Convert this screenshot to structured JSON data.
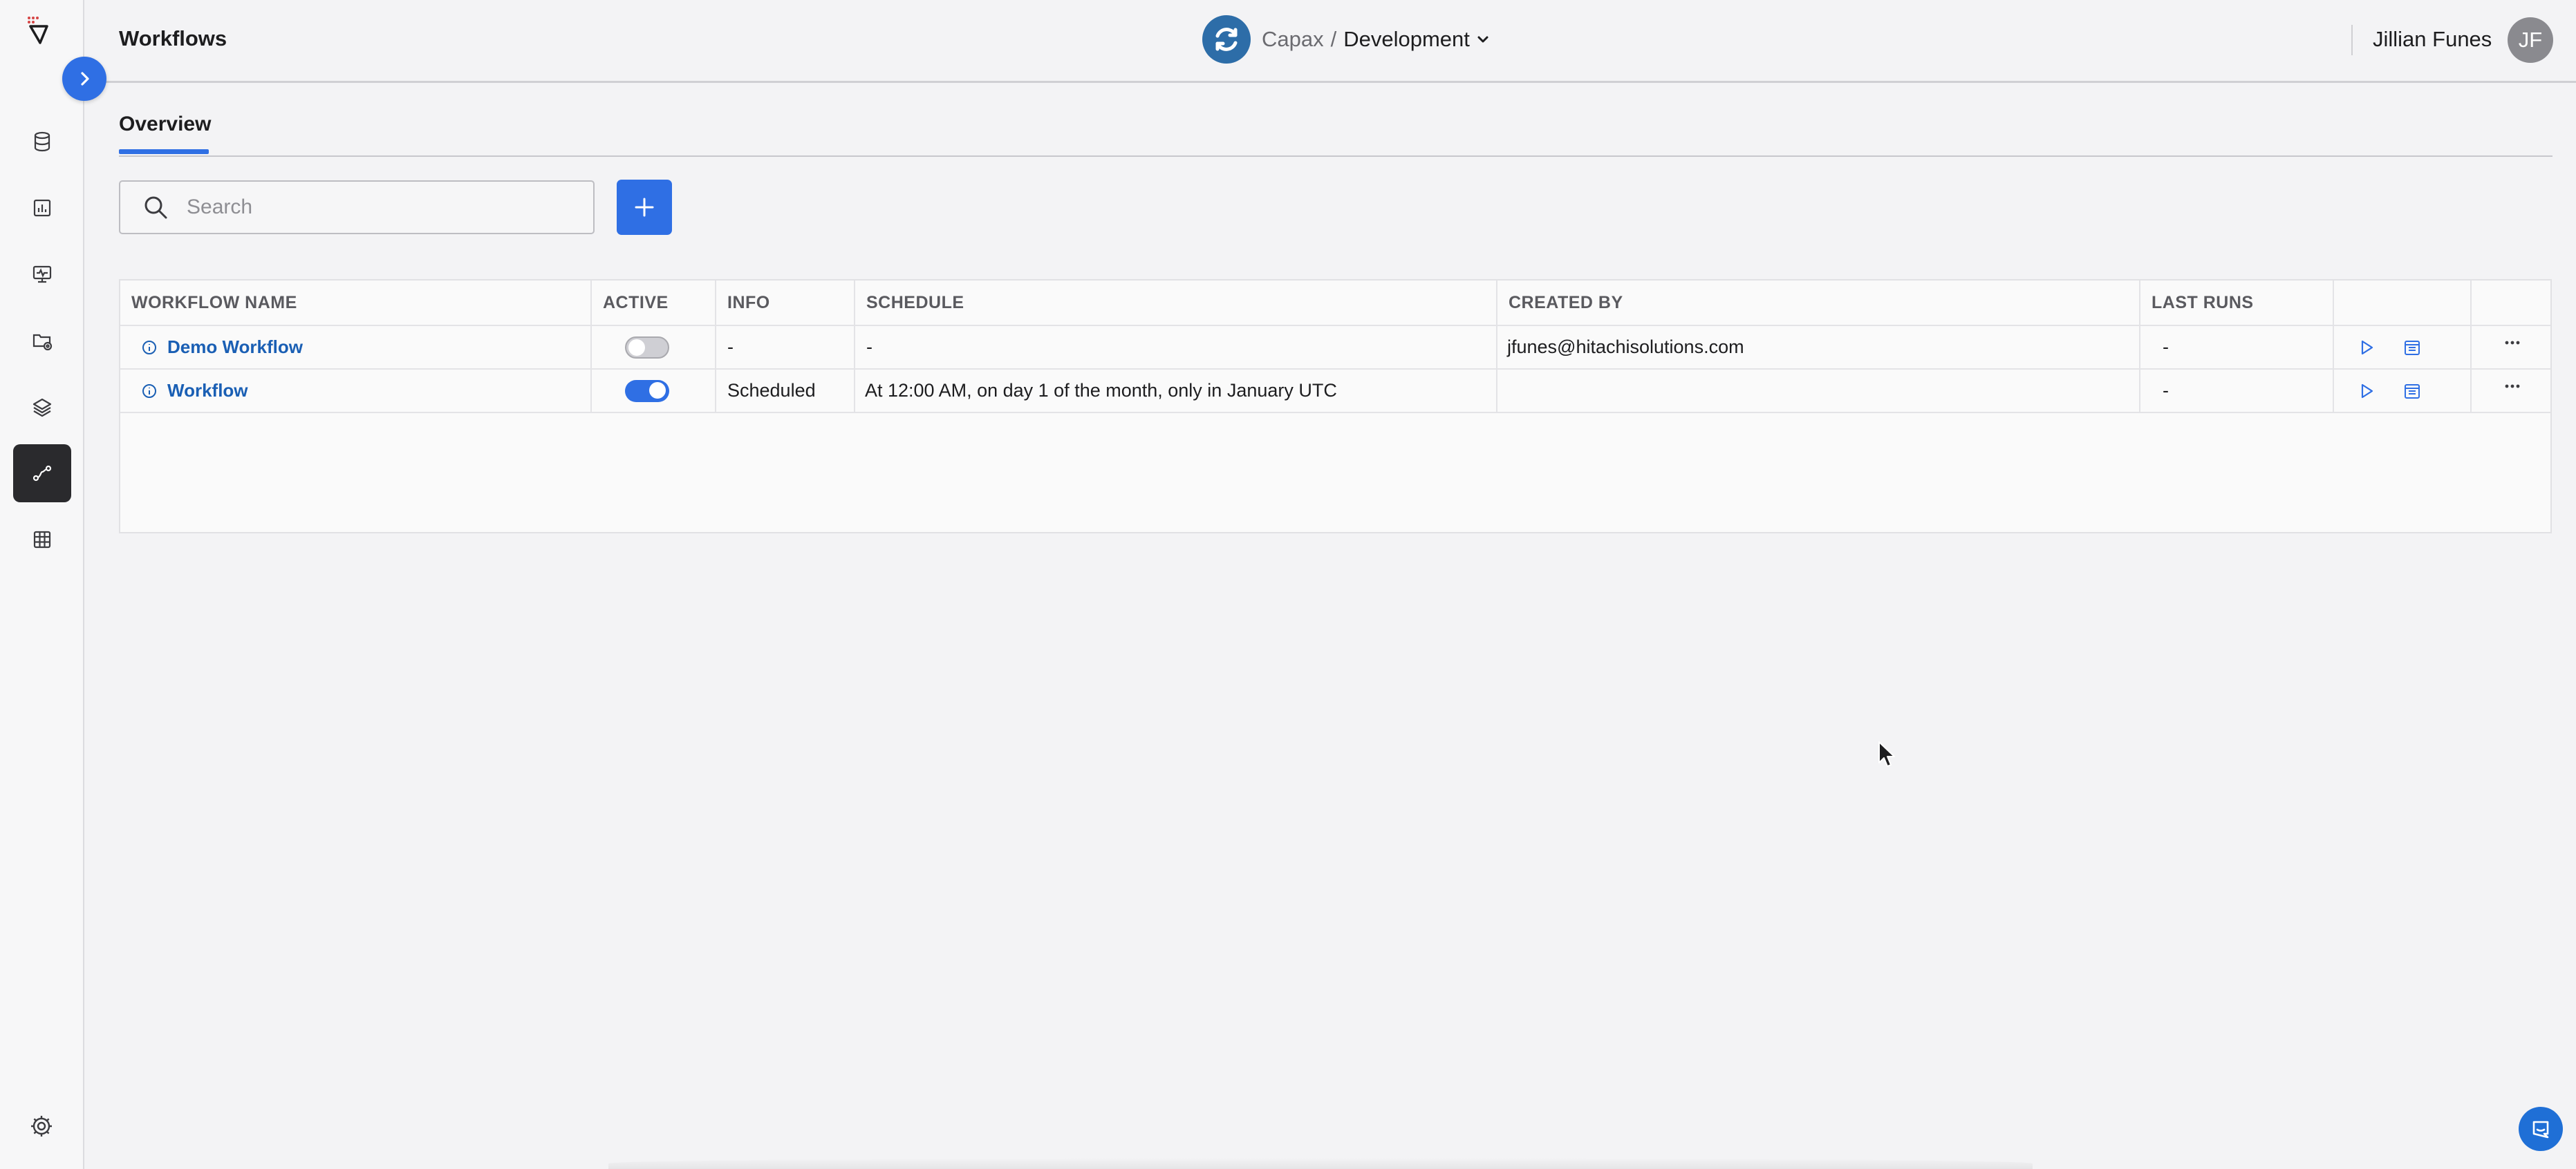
{
  "app": {
    "page_title": "Workflows",
    "project": {
      "org": "Capax",
      "separator": "/",
      "environment": "Development"
    },
    "user": {
      "name": "Jillian Funes",
      "initials": "JF"
    }
  },
  "sidebar": {
    "items": [
      {
        "name": "database-icon",
        "active": false
      },
      {
        "name": "chart-icon",
        "active": false
      },
      {
        "name": "monitor-icon",
        "active": false
      },
      {
        "name": "folder-settings-icon",
        "active": false
      },
      {
        "name": "layers-icon",
        "active": false
      },
      {
        "name": "workflow-icon",
        "active": true
      },
      {
        "name": "table-grid-icon",
        "active": false
      }
    ],
    "settings_icon": "gear-icon"
  },
  "tabs": [
    {
      "label": "Overview",
      "active": true
    }
  ],
  "search": {
    "placeholder": "Search",
    "value": ""
  },
  "table": {
    "headers": {
      "workflow_name": "WORKFLOW NAME",
      "active": "ACTIVE",
      "info": "INFO",
      "schedule": "SCHEDULE",
      "created_by": "CREATED BY",
      "last_runs": "LAST RUNS"
    },
    "rows": [
      {
        "name": "Demo Workflow",
        "active": false,
        "info": "-",
        "schedule": "-",
        "created_by": "jfunes@hitachisolutions.com",
        "last_runs": "-"
      },
      {
        "name": "Workflow",
        "active": true,
        "info": "Scheduled",
        "schedule": "At 12:00 AM, on day 1 of the month, only in January UTC",
        "created_by": "",
        "last_runs": "-"
      }
    ]
  },
  "colors": {
    "accent": "#2f6fe4",
    "link": "#1a5fb4",
    "sidebar_active": "#2a2a2d",
    "chat_button": "#1f6fd6"
  }
}
